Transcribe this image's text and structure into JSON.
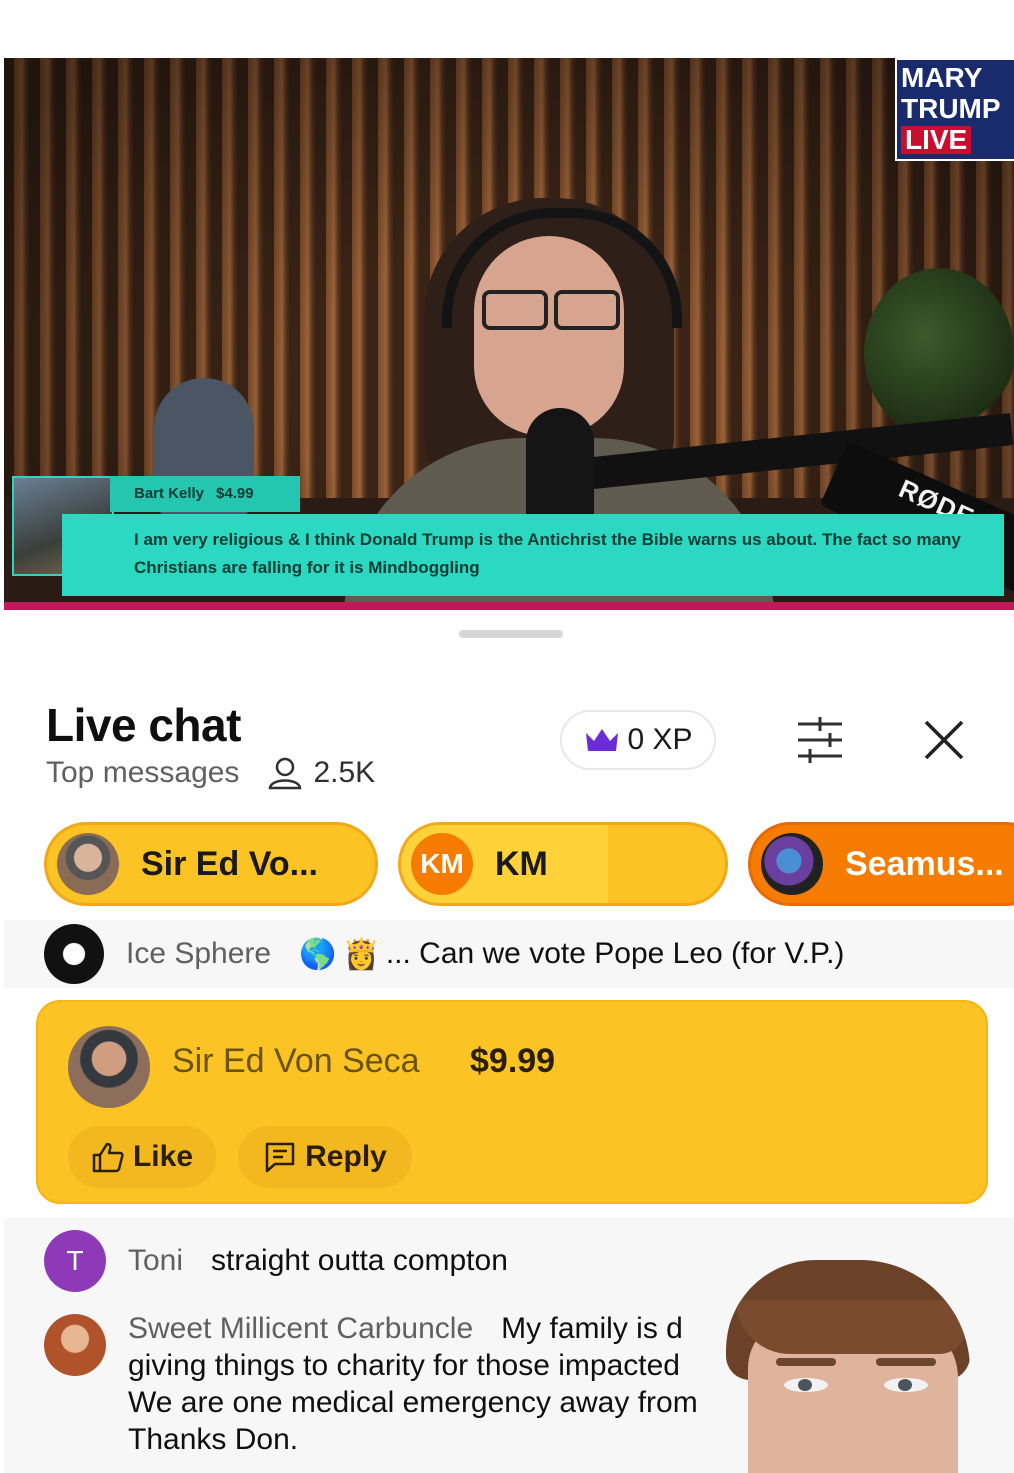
{
  "video": {
    "logo": {
      "line1": "MARY",
      "line2": "TRUMP",
      "line3": "LIVE"
    },
    "mic_brand": "RØDE",
    "superchat": {
      "name": "Bart Kelly",
      "amount": "$4.99",
      "message": "I am very religious & I think Donald Trump is the Antichrist the Bible warns us about. The fact so many Christians are falling for it is Mindboggling"
    }
  },
  "chat": {
    "title": "Live chat",
    "mode": "Top messages",
    "viewers": "2.5K",
    "xp_label": "0 XP",
    "icons": {
      "xp": "crown-icon",
      "filter": "sliders-icon",
      "close": "close-icon",
      "viewers": "person-icon"
    }
  },
  "chips": [
    {
      "label": "Sir Ed Vo...",
      "avatar": ""
    },
    {
      "label": "KM",
      "avatar": "KM",
      "progress": 0.64
    },
    {
      "label": "Seamus...",
      "avatar": ""
    }
  ],
  "messages": {
    "ice": {
      "author": "Ice Sphere",
      "emoji": [
        "🌎",
        "👸"
      ],
      "text": "... Can we vote Pope Leo (for V.P.)"
    },
    "superchat": {
      "author": "Sir Ed Von Seca",
      "amount": "$9.99",
      "like_label": "Like",
      "reply_label": "Reply"
    },
    "toni": {
      "avatar_letter": "T",
      "author": "Toni",
      "text": "straight outta compton"
    },
    "sweet": {
      "author": "Sweet Millicent Carbuncle",
      "text": "My family is d",
      "line2": "giving things to charity for those impacted",
      "line3": "We are one medical emergency away from",
      "line4": "Thanks Don."
    }
  },
  "colors": {
    "superchat_yellow": "#fbc323",
    "chip_orange": "#f57c00",
    "overlay_teal": "#2bd9c2",
    "accent_pink": "#c2185b"
  }
}
